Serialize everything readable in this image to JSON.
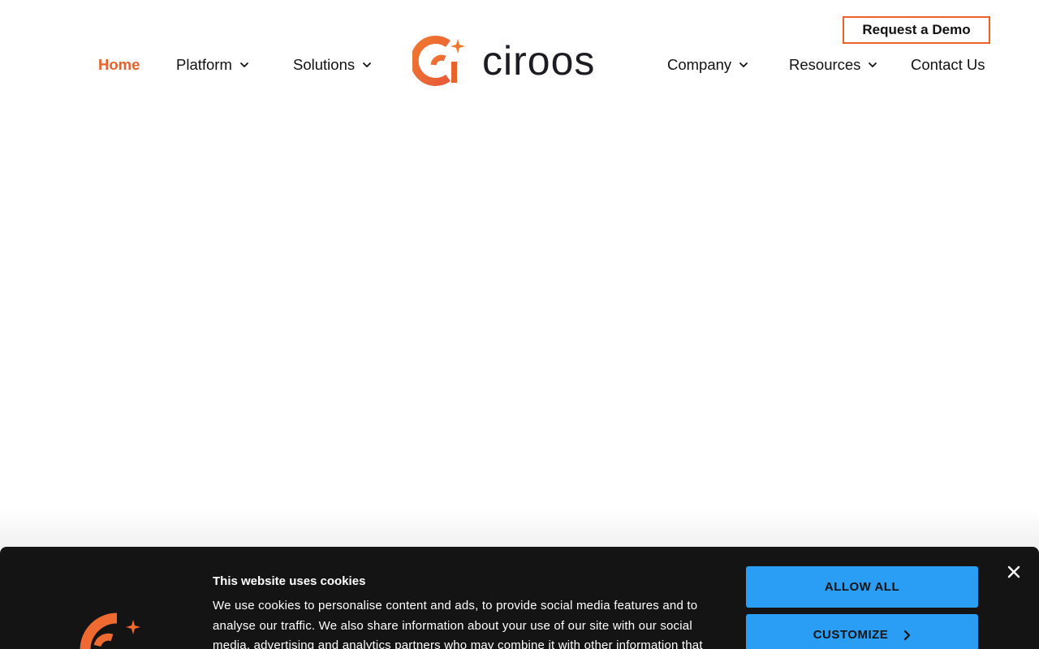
{
  "header": {
    "demo_button": "Request a Demo",
    "brand": "ciroos",
    "nav": [
      {
        "label": "Home",
        "active": true
      },
      {
        "label": "Platform",
        "dropdown": true
      },
      {
        "label": "Solutions",
        "dropdown": true
      },
      {
        "label": "Company",
        "dropdown": true
      },
      {
        "label": "Resources",
        "dropdown": true
      },
      {
        "label": "Contact Us"
      }
    ]
  },
  "cookie_banner": {
    "title": "This website uses cookies",
    "text": "We use cookies to personalise content and ads, to provide social media features and to analyse our traffic. We also share information about your use of our site with our social media, advertising and analytics partners who may combine it with other information that",
    "allow_all": "ALLOW ALL",
    "customize": "CUSTOMIZE"
  },
  "colors": {
    "accent": "#e8622c",
    "cookie_bg": "#141414",
    "button_blue": "#2a9df4"
  },
  "icons": [
    "chevron-down-icon",
    "close-icon",
    "chevron-right-icon",
    "ciroos-logo-mark"
  ]
}
